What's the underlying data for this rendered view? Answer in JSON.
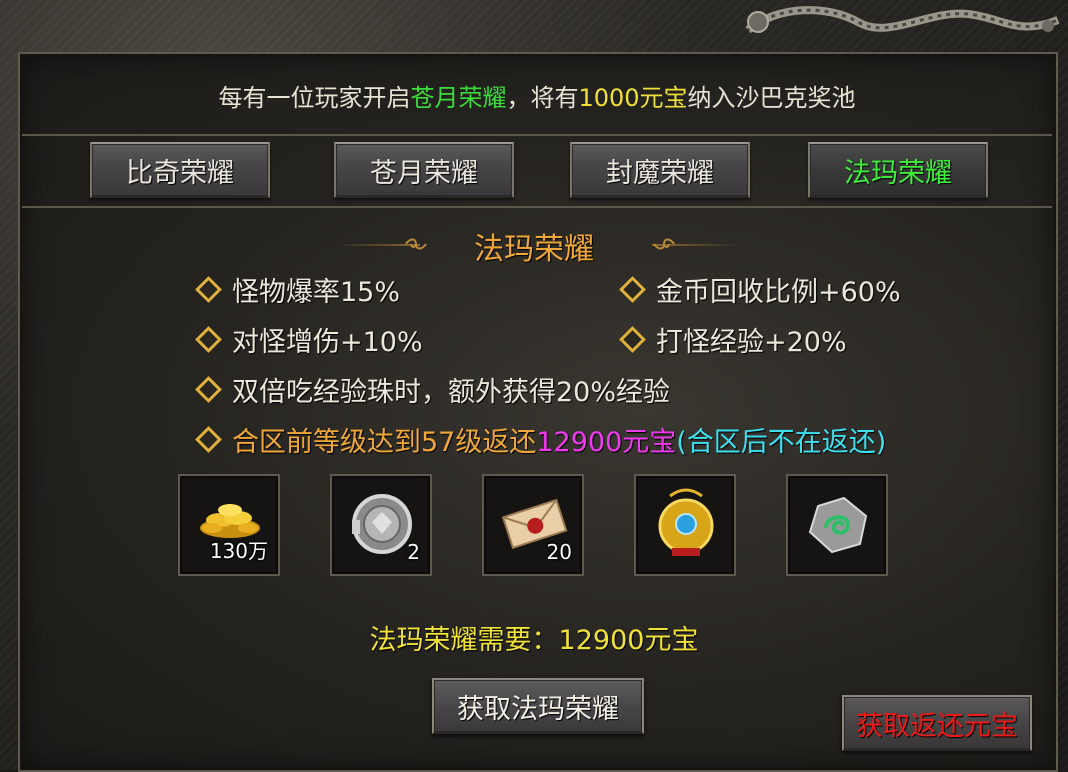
{
  "notice": {
    "prefix": "每有一位玩家开启",
    "honor_name": "苍月荣耀",
    "middle": "，将有",
    "amount": "1000元宝",
    "suffix": "纳入沙巴克奖池"
  },
  "tabs": [
    {
      "label": "比奇荣耀",
      "active": false
    },
    {
      "label": "苍月荣耀",
      "active": false
    },
    {
      "label": "封魔荣耀",
      "active": false
    },
    {
      "label": "法玛荣耀",
      "active": true
    }
  ],
  "section_title": "法玛荣耀",
  "features": {
    "f1": "怪物爆率15%",
    "f2": "金币回收比例+60%",
    "f3": "对怪增伤+10%",
    "f4": "打怪经验+20%",
    "f5": "双倍吃经验珠时，额外获得20%经验",
    "f6_prefix": "合区前等级达到57级返还",
    "f6_amount": "12900元宝",
    "f6_suffix": "(合区后不在返还)"
  },
  "rewards": [
    {
      "icon": "gold-coins-icon",
      "count": "130万"
    },
    {
      "icon": "silver-medal-icon",
      "count": "2"
    },
    {
      "icon": "sealed-letter-icon",
      "count": "20"
    },
    {
      "icon": "gold-amulet-icon",
      "count": ""
    },
    {
      "icon": "jade-stone-icon",
      "count": ""
    }
  ],
  "requirement": "法玛荣耀需要：12900元宝",
  "buttons": {
    "get_honor": "获取法玛荣耀",
    "get_return": "获取返还元宝"
  },
  "colors": {
    "green": "#3cdc3c",
    "yellow": "#f0e03a",
    "orange": "#f0a73a",
    "magenta": "#f03af0",
    "cyan": "#3ee0f0",
    "red": "#ee1a1a"
  }
}
